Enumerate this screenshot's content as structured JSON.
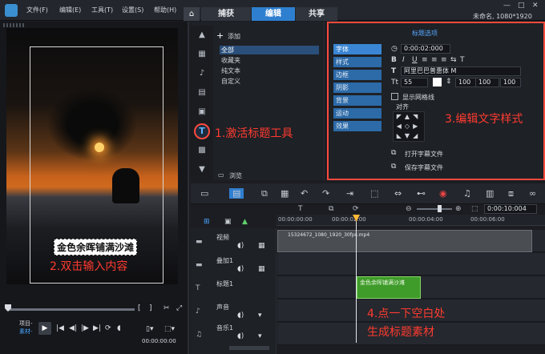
{
  "menu": {
    "items": [
      "文件(F)",
      "编辑(E)",
      "工具(T)",
      "设置(S)",
      "帮助(H)"
    ]
  },
  "tabs": {
    "capture": "捕获",
    "edit": "编辑",
    "share": "共享"
  },
  "status": {
    "project": "未命名, 1080*1920"
  },
  "player": {
    "title_text": "金色余晖铺满沙滩",
    "project_label": "项目-",
    "material_label": "素材-",
    "timecode": "00:00:00:00"
  },
  "annotations": {
    "a1": "1.激活标题工具",
    "a2": "2.双击输入内容",
    "a3": "3.编辑文字样式",
    "a4": "4.点一下空白处",
    "a4b": "生成标题素材"
  },
  "library": {
    "add": "添加",
    "items": [
      "全部",
      "收藏夹",
      "纯文本",
      "自定义"
    ],
    "browse": "浏览"
  },
  "options": {
    "title": "标题选项",
    "sections": [
      "字体",
      "样式",
      "边框",
      "阴影",
      "背景",
      "运动",
      "效果"
    ],
    "duration": "0:00:02:000",
    "font": "阿里巴巴普惠体 M",
    "size": "55",
    "line_spacing": "100",
    "scale_a": "100",
    "scale_b": "100",
    "show_grid": "显示网格线",
    "align": "对齐",
    "open_sub": "打开字幕文件",
    "save_sub": "保存字幕文件"
  },
  "timeline": {
    "ticks": [
      "00:00:00:00",
      "00:00:02:00",
      "00:00:04:00",
      "00:00:06:00"
    ],
    "timecode": "0:00:10:004",
    "tracks": [
      "视频",
      "叠加1",
      "标题1",
      "声音",
      "音乐1"
    ],
    "video_clip": "15324672_1080_1920_30fps.mp4",
    "title_clip": "金色余晖铺满沙滩"
  }
}
